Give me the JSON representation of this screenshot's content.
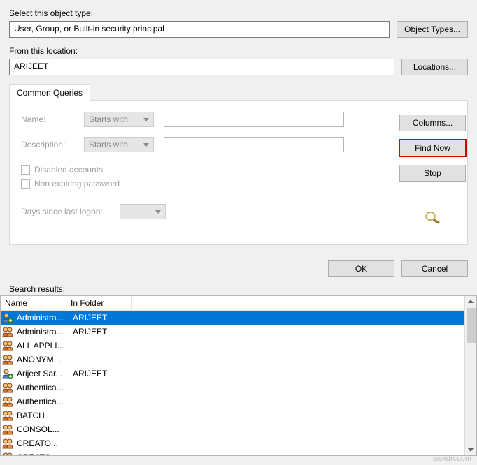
{
  "objectType": {
    "label": "Select this object type:",
    "value": "User, Group, or Built-in security principal",
    "button": "Object Types..."
  },
  "location": {
    "label": "From this location:",
    "value": "ARIJEET",
    "button": "Locations..."
  },
  "tab": "Common Queries",
  "query": {
    "nameLbl": "Name:",
    "nameMode": "Starts with",
    "descLbl": "Description:",
    "descMode": "Starts with",
    "disabled": "Disabled accounts",
    "nonexp": "Non expiring password",
    "daysLbl": "Days since last logon:"
  },
  "side": {
    "columns": "Columns...",
    "findnow": "Find Now",
    "stop": "Stop"
  },
  "ok": "OK",
  "cancel": "Cancel",
  "resultsLbl": "Search results:",
  "cols": {
    "name": "Name",
    "folder": "In Folder"
  },
  "rows": [
    {
      "name": "Administra...",
      "folder": "ARIJEET",
      "sel": true,
      "type": "user"
    },
    {
      "name": "Administra...",
      "folder": "ARIJEET",
      "sel": false,
      "type": "group"
    },
    {
      "name": "ALL APPLI...",
      "folder": "",
      "sel": false,
      "type": "group"
    },
    {
      "name": "ANONYM...",
      "folder": "",
      "sel": false,
      "type": "group"
    },
    {
      "name": "Arijeet Sar...",
      "folder": "ARIJEET",
      "sel": false,
      "type": "user"
    },
    {
      "name": "Authentica...",
      "folder": "",
      "sel": false,
      "type": "group"
    },
    {
      "name": "Authentica...",
      "folder": "",
      "sel": false,
      "type": "group"
    },
    {
      "name": "BATCH",
      "folder": "",
      "sel": false,
      "type": "group"
    },
    {
      "name": "CONSOL...",
      "folder": "",
      "sel": false,
      "type": "group"
    },
    {
      "name": "CREATO...",
      "folder": "",
      "sel": false,
      "type": "group"
    },
    {
      "name": "CREATO...",
      "folder": "",
      "sel": false,
      "type": "group"
    }
  ],
  "watermark": "wsxdn.com"
}
